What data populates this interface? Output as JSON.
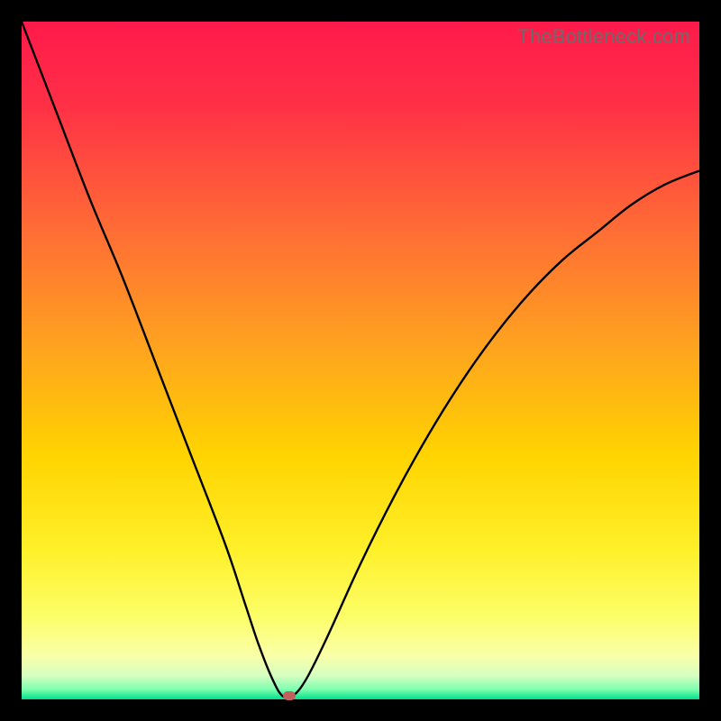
{
  "watermark": "TheBottleneck.com",
  "colors": {
    "gradient_stops": [
      {
        "offset": 0.0,
        "color": "#ff1a4b"
      },
      {
        "offset": 0.12,
        "color": "#ff2f46"
      },
      {
        "offset": 0.3,
        "color": "#ff6a36"
      },
      {
        "offset": 0.48,
        "color": "#ffa31f"
      },
      {
        "offset": 0.64,
        "color": "#ffd400"
      },
      {
        "offset": 0.78,
        "color": "#fff02a"
      },
      {
        "offset": 0.88,
        "color": "#fcff6a"
      },
      {
        "offset": 0.935,
        "color": "#faffa8"
      },
      {
        "offset": 0.965,
        "color": "#d6ffc0"
      },
      {
        "offset": 0.985,
        "color": "#7fffb0"
      },
      {
        "offset": 1.0,
        "color": "#00e08a"
      }
    ],
    "curve": "#000000",
    "marker": "#c1605d",
    "frame": "#000000"
  },
  "chart_data": {
    "type": "line",
    "title": "",
    "xlabel": "",
    "ylabel": "",
    "xlim": [
      0,
      100
    ],
    "ylim": [
      0,
      100
    ],
    "series": [
      {
        "name": "bottleneck-curve",
        "x": [
          0,
          5,
          10,
          15,
          20,
          25,
          30,
          33,
          35,
          37,
          38.5,
          40,
          42,
          45,
          50,
          55,
          60,
          65,
          70,
          75,
          80,
          85,
          90,
          95,
          100
        ],
        "y": [
          100,
          87,
          74,
          62,
          49,
          36,
          23,
          14,
          8,
          3,
          0.5,
          0.5,
          3,
          9,
          20,
          30,
          39,
          47,
          54,
          60,
          65,
          69,
          73,
          76,
          78
        ]
      }
    ],
    "marker": {
      "x": 39.5,
      "y": 0.5
    },
    "annotations": [
      {
        "text": "TheBottleneck.com",
        "role": "watermark",
        "position": "top-right"
      }
    ]
  }
}
